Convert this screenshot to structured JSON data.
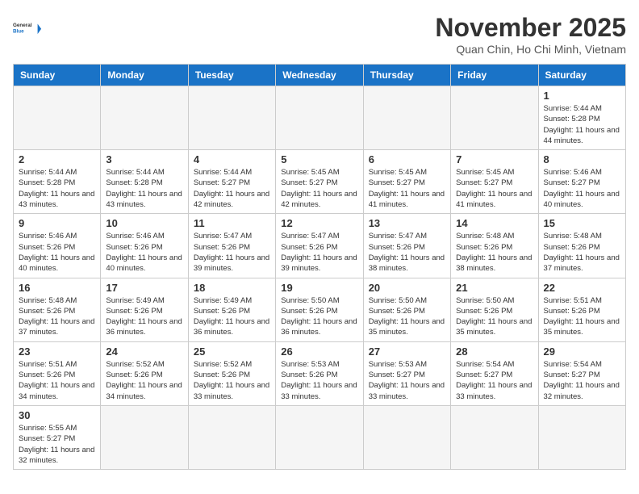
{
  "header": {
    "logo_general": "General",
    "logo_blue": "Blue",
    "month_title": "November 2025",
    "location": "Quan Chin, Ho Chi Minh, Vietnam"
  },
  "days_of_week": [
    "Sunday",
    "Monday",
    "Tuesday",
    "Wednesday",
    "Thursday",
    "Friday",
    "Saturday"
  ],
  "weeks": [
    [
      {
        "day": "",
        "info": ""
      },
      {
        "day": "",
        "info": ""
      },
      {
        "day": "",
        "info": ""
      },
      {
        "day": "",
        "info": ""
      },
      {
        "day": "",
        "info": ""
      },
      {
        "day": "",
        "info": ""
      },
      {
        "day": "1",
        "info": "Sunrise: 5:44 AM\nSunset: 5:28 PM\nDaylight: 11 hours and 44 minutes."
      }
    ],
    [
      {
        "day": "2",
        "info": "Sunrise: 5:44 AM\nSunset: 5:28 PM\nDaylight: 11 hours and 43 minutes."
      },
      {
        "day": "3",
        "info": "Sunrise: 5:44 AM\nSunset: 5:28 PM\nDaylight: 11 hours and 43 minutes."
      },
      {
        "day": "4",
        "info": "Sunrise: 5:44 AM\nSunset: 5:27 PM\nDaylight: 11 hours and 42 minutes."
      },
      {
        "day": "5",
        "info": "Sunrise: 5:45 AM\nSunset: 5:27 PM\nDaylight: 11 hours and 42 minutes."
      },
      {
        "day": "6",
        "info": "Sunrise: 5:45 AM\nSunset: 5:27 PM\nDaylight: 11 hours and 41 minutes."
      },
      {
        "day": "7",
        "info": "Sunrise: 5:45 AM\nSunset: 5:27 PM\nDaylight: 11 hours and 41 minutes."
      },
      {
        "day": "8",
        "info": "Sunrise: 5:46 AM\nSunset: 5:27 PM\nDaylight: 11 hours and 40 minutes."
      }
    ],
    [
      {
        "day": "9",
        "info": "Sunrise: 5:46 AM\nSunset: 5:26 PM\nDaylight: 11 hours and 40 minutes."
      },
      {
        "day": "10",
        "info": "Sunrise: 5:46 AM\nSunset: 5:26 PM\nDaylight: 11 hours and 40 minutes."
      },
      {
        "day": "11",
        "info": "Sunrise: 5:47 AM\nSunset: 5:26 PM\nDaylight: 11 hours and 39 minutes."
      },
      {
        "day": "12",
        "info": "Sunrise: 5:47 AM\nSunset: 5:26 PM\nDaylight: 11 hours and 39 minutes."
      },
      {
        "day": "13",
        "info": "Sunrise: 5:47 AM\nSunset: 5:26 PM\nDaylight: 11 hours and 38 minutes."
      },
      {
        "day": "14",
        "info": "Sunrise: 5:48 AM\nSunset: 5:26 PM\nDaylight: 11 hours and 38 minutes."
      },
      {
        "day": "15",
        "info": "Sunrise: 5:48 AM\nSunset: 5:26 PM\nDaylight: 11 hours and 37 minutes."
      }
    ],
    [
      {
        "day": "16",
        "info": "Sunrise: 5:48 AM\nSunset: 5:26 PM\nDaylight: 11 hours and 37 minutes."
      },
      {
        "day": "17",
        "info": "Sunrise: 5:49 AM\nSunset: 5:26 PM\nDaylight: 11 hours and 36 minutes."
      },
      {
        "day": "18",
        "info": "Sunrise: 5:49 AM\nSunset: 5:26 PM\nDaylight: 11 hours and 36 minutes."
      },
      {
        "day": "19",
        "info": "Sunrise: 5:50 AM\nSunset: 5:26 PM\nDaylight: 11 hours and 36 minutes."
      },
      {
        "day": "20",
        "info": "Sunrise: 5:50 AM\nSunset: 5:26 PM\nDaylight: 11 hours and 35 minutes."
      },
      {
        "day": "21",
        "info": "Sunrise: 5:50 AM\nSunset: 5:26 PM\nDaylight: 11 hours and 35 minutes."
      },
      {
        "day": "22",
        "info": "Sunrise: 5:51 AM\nSunset: 5:26 PM\nDaylight: 11 hours and 35 minutes."
      }
    ],
    [
      {
        "day": "23",
        "info": "Sunrise: 5:51 AM\nSunset: 5:26 PM\nDaylight: 11 hours and 34 minutes."
      },
      {
        "day": "24",
        "info": "Sunrise: 5:52 AM\nSunset: 5:26 PM\nDaylight: 11 hours and 34 minutes."
      },
      {
        "day": "25",
        "info": "Sunrise: 5:52 AM\nSunset: 5:26 PM\nDaylight: 11 hours and 33 minutes."
      },
      {
        "day": "26",
        "info": "Sunrise: 5:53 AM\nSunset: 5:26 PM\nDaylight: 11 hours and 33 minutes."
      },
      {
        "day": "27",
        "info": "Sunrise: 5:53 AM\nSunset: 5:27 PM\nDaylight: 11 hours and 33 minutes."
      },
      {
        "day": "28",
        "info": "Sunrise: 5:54 AM\nSunset: 5:27 PM\nDaylight: 11 hours and 33 minutes."
      },
      {
        "day": "29",
        "info": "Sunrise: 5:54 AM\nSunset: 5:27 PM\nDaylight: 11 hours and 32 minutes."
      }
    ],
    [
      {
        "day": "30",
        "info": "Sunrise: 5:55 AM\nSunset: 5:27 PM\nDaylight: 11 hours and 32 minutes."
      },
      {
        "day": "",
        "info": ""
      },
      {
        "day": "",
        "info": ""
      },
      {
        "day": "",
        "info": ""
      },
      {
        "day": "",
        "info": ""
      },
      {
        "day": "",
        "info": ""
      },
      {
        "day": "",
        "info": ""
      }
    ]
  ]
}
